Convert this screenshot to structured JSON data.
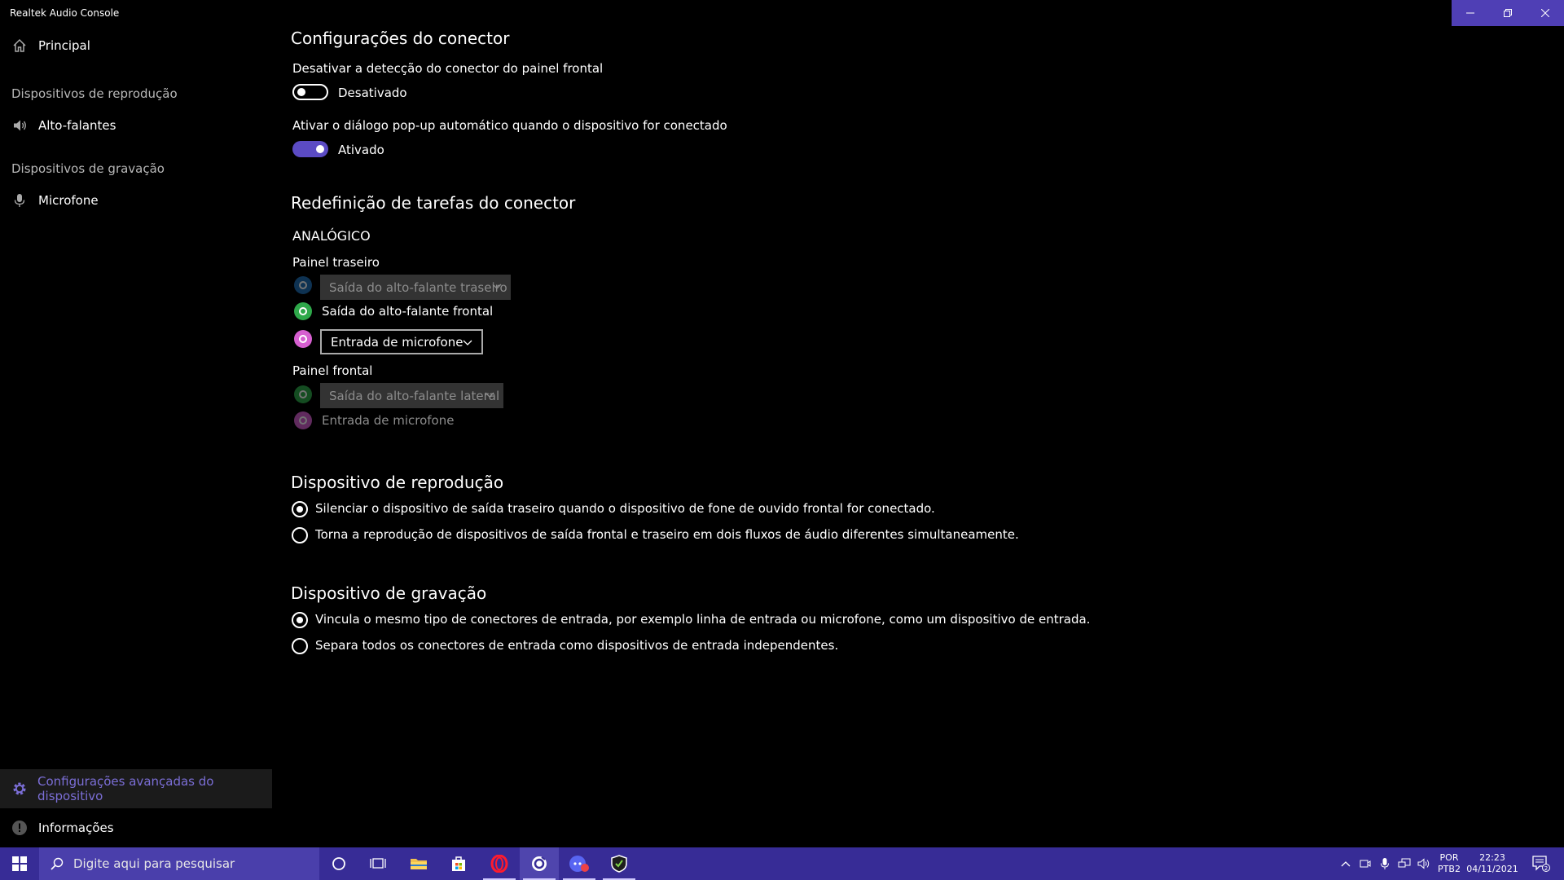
{
  "window": {
    "title": "Realtek Audio Console",
    "accent_color": "#4f3fb5"
  },
  "sidebar": {
    "home": "Principal",
    "playback_header": "Dispositivos de reprodução",
    "speakers": "Alto-falantes",
    "recording_header": "Dispositivos de gravação",
    "microphone": "Microfone",
    "advanced": "Configurações avançadas do dispositivo",
    "info": "Informações"
  },
  "connector_settings": {
    "title": "Configurações do conector",
    "front_panel_detection": {
      "label": "Desativar a detecção do conector do painel frontal",
      "state": "Desativado",
      "on": false
    },
    "auto_popup": {
      "label": "Ativar o diálogo pop-up automático quando o dispositivo for conectado",
      "state": "Ativado",
      "on": true
    }
  },
  "retasking": {
    "title": "Redefinição de tarefas do conector",
    "group": "ANALÓGICO",
    "rear_panel": {
      "label": "Painel traseiro",
      "jack1": "Saída do alto-falante traseiro",
      "jack2": "Saída do alto-falante frontal",
      "jack3": "Entrada de microfone"
    },
    "front_panel": {
      "label": "Painel frontal",
      "jack1": "Saída do alto-falante lateral",
      "jack2": "Entrada de microfone"
    }
  },
  "playback_device": {
    "title": "Dispositivo de reprodução",
    "option1": "Silenciar o dispositivo de saída traseiro quando o dispositivo de fone de ouvido frontal for conectado.",
    "option2": "Torna a reprodução de dispositivos de saída frontal e traseiro em dois fluxos de áudio diferentes simultaneamente.",
    "selected": 1
  },
  "recording_device": {
    "title": "Dispositivo de gravação",
    "option1": "Vincula o mesmo tipo de conectores de entrada, por exemplo linha de entrada ou microfone, como um dispositivo de entrada.",
    "option2": "Separa todos os conectores de entrada como dispositivos de entrada independentes.",
    "selected": 1
  },
  "taskbar": {
    "search_placeholder": "Digite aqui para pesquisar",
    "language": "POR",
    "layout": "PTB2",
    "time": "22:23",
    "date": "04/11/2021",
    "notifications": "2",
    "color": "#372c96"
  }
}
